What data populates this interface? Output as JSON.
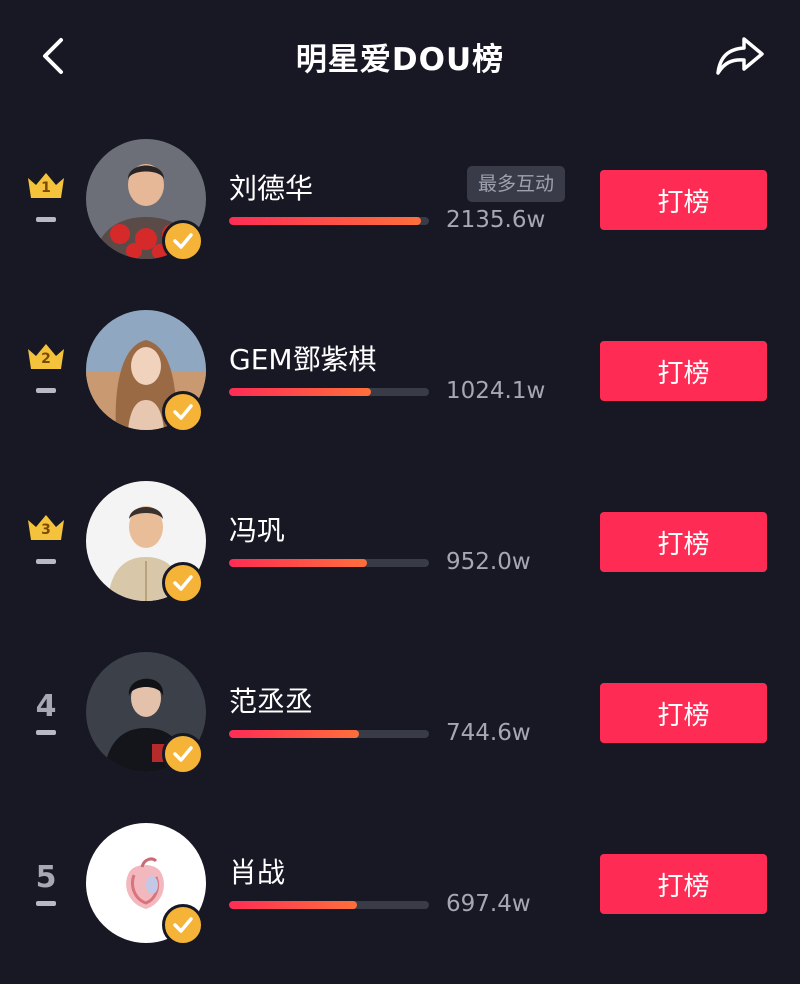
{
  "header": {
    "title": "明星爱DOU榜",
    "back_icon": "chevron-left-icon",
    "share_icon": "share-arrow-icon"
  },
  "colors": {
    "background": "#171824",
    "accent": "#fe2c55",
    "crown": "#f5c33b",
    "badge": "#f5b437"
  },
  "tag_label": "最多互动",
  "button_label": "打榜",
  "rows": [
    {
      "rank": "1",
      "crown": true,
      "name": "刘德华",
      "score": "2135.6w",
      "progress": 0.96,
      "tag": true,
      "avatar": "red-flower-sweater"
    },
    {
      "rank": "2",
      "crown": true,
      "name": "GEM鄧紫棋",
      "score": "1024.1w",
      "progress": 0.71,
      "tag": false,
      "avatar": "desert-long-hair"
    },
    {
      "rank": "3",
      "crown": true,
      "name": "冯巩",
      "score": "952.0w",
      "progress": 0.69,
      "tag": false,
      "avatar": "white-suit"
    },
    {
      "rank": "4",
      "crown": false,
      "name": "范丞丞",
      "score": "744.6w",
      "progress": 0.65,
      "tag": false,
      "avatar": "dark-suit"
    },
    {
      "rank": "5",
      "crown": false,
      "name": "肖战",
      "score": "697.4w",
      "progress": 0.64,
      "tag": false,
      "avatar": "heart-illustration"
    }
  ]
}
